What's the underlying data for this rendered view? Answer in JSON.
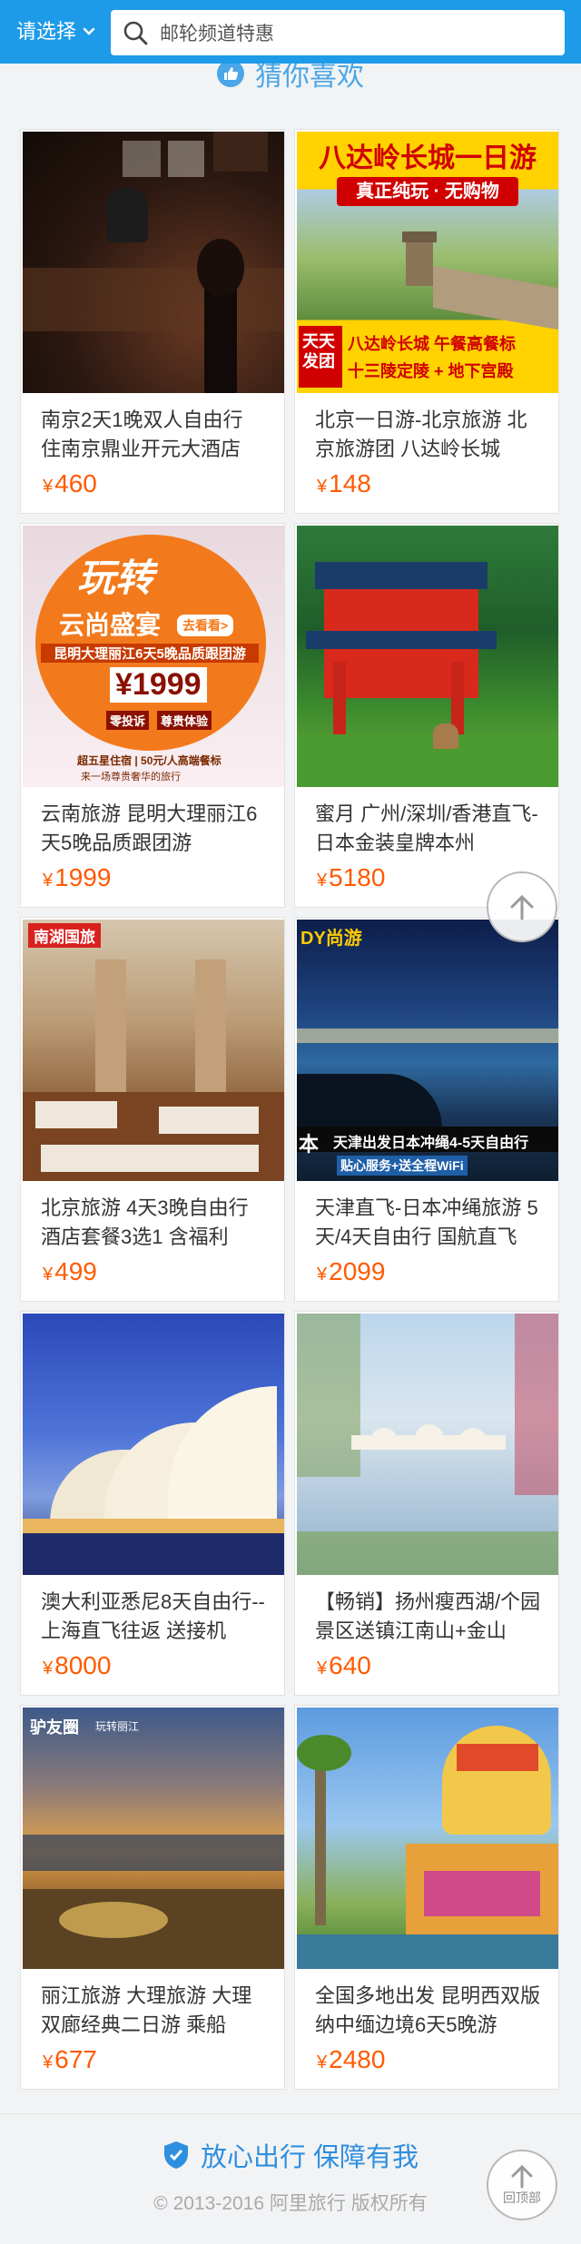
{
  "header": {
    "region_label": "请选择",
    "search_placeholder": "邮轮频道特惠"
  },
  "section": {
    "title": "猜你喜欢"
  },
  "products": [
    {
      "title": "南京2天1晚双人自由行 住南京鼎业开元大酒店",
      "currency": "¥",
      "price": "460",
      "overlay": []
    },
    {
      "title": "北京一日游-北京旅游 北京旅游团 八达岭长城",
      "currency": "¥",
      "price": "148",
      "overlay": [
        "八达岭长城一日游",
        "真正纯玩 · 无购物",
        "天天发团",
        "八达岭长城 午餐高餐标",
        "十三陵定陵 + 地下宫殿"
      ]
    },
    {
      "title": "云南旅游 昆明大理丽江6天5晚品质跟团游",
      "currency": "¥",
      "price": "1999",
      "overlay": [
        "玩转",
        "云尚盛宴",
        "去看看>",
        "昆明大理丽江6天5晚品质跟团游",
        "¥1999",
        "零投诉",
        "尊贵体验",
        "超五星住宿 | 50元/人高端餐标",
        "来一场尊贵奢华的旅行"
      ]
    },
    {
      "title": "蜜月 广州/深圳/香港直飞-日本金装皇牌本州",
      "currency": "¥",
      "price": "5180",
      "overlay": []
    },
    {
      "title": "北京旅游 4天3晚自由行 酒店套餐3选1 含福利",
      "currency": "¥",
      "price": "499",
      "overlay": [
        "南湖国旅"
      ]
    },
    {
      "title": "天津直飞-日本冲绳旅游 5天/4天自由行 国航直飞",
      "currency": "¥",
      "price": "2099",
      "overlay": [
        "DY尚游",
        "本",
        "天津出发日本冲绳4-5天自由行",
        "贴心服务+送全程WiFi"
      ]
    },
    {
      "title": "澳大利亚悉尼8天自由行--上海直飞往返 送接机",
      "currency": "¥",
      "price": "8000",
      "overlay": []
    },
    {
      "title": "【畅销】扬州瘦西湖/个园景区送镇江南山+金山",
      "currency": "¥",
      "price": "640",
      "overlay": []
    },
    {
      "title": "丽江旅游 大理旅游 大理双廊经典二日游 乘船",
      "currency": "¥",
      "price": "677",
      "overlay": [
        "驴友圈",
        "玩转丽江"
      ]
    },
    {
      "title": "全国多地出发 昆明西双版纳中缅边境6天5晚游",
      "currency": "¥",
      "price": "2480",
      "overlay": []
    }
  ],
  "back_to_top": {
    "label": "回顶部"
  },
  "footer": {
    "assurance": "放心出行 保障有我",
    "copyright": "© 2013-2016 阿里旅行 版权所有"
  },
  "colors": {
    "brand_blue": "#1e9be8",
    "price_orange": "#ff5a00",
    "footer_blue": "#2e8fe0"
  }
}
